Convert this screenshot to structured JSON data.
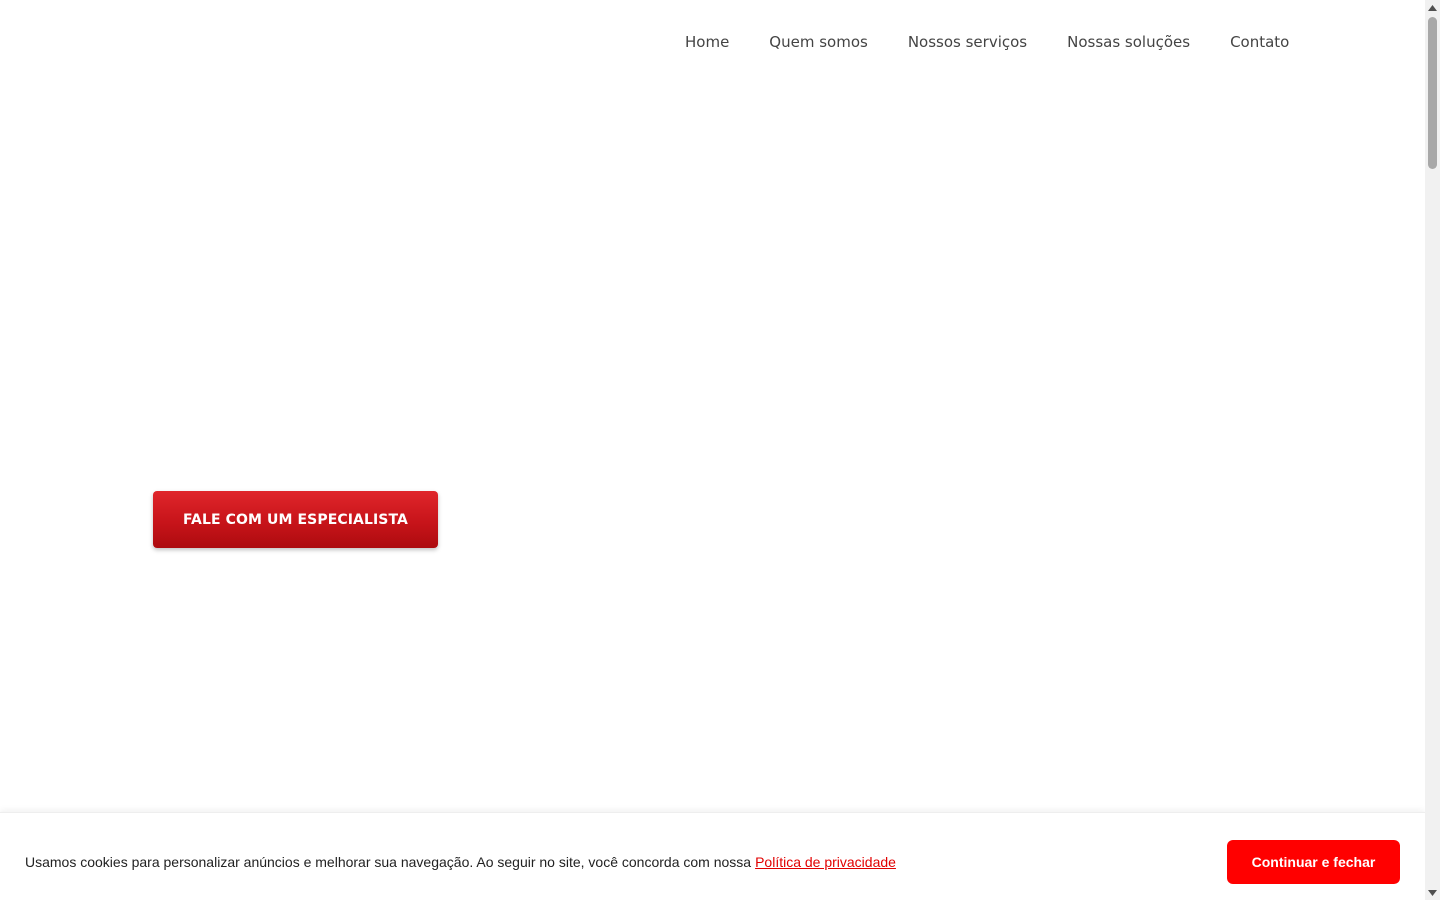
{
  "nav": {
    "items": [
      {
        "label": "Home"
      },
      {
        "label": "Quem somos"
      },
      {
        "label": "Nossos serviços"
      },
      {
        "label": "Nossas soluções"
      },
      {
        "label": "Contato"
      }
    ]
  },
  "hero": {
    "cta_label": "FALE COM UM ESPECIALISTA"
  },
  "cookie": {
    "message": "Usamos cookies para personalizar anúncios e melhorar sua navegação. Ao seguir no site, você concorda com nossa",
    "link_label": "Política de privacidade",
    "button_label": "Continuar e fechar"
  },
  "colors": {
    "brand_red": "#c7141a",
    "cookie_button": "#ff0000",
    "link_red": "#e10000",
    "nav_text": "#444444"
  },
  "icons": {
    "scroll_up": "chevron-up-icon",
    "scroll_down": "chevron-down-icon"
  }
}
